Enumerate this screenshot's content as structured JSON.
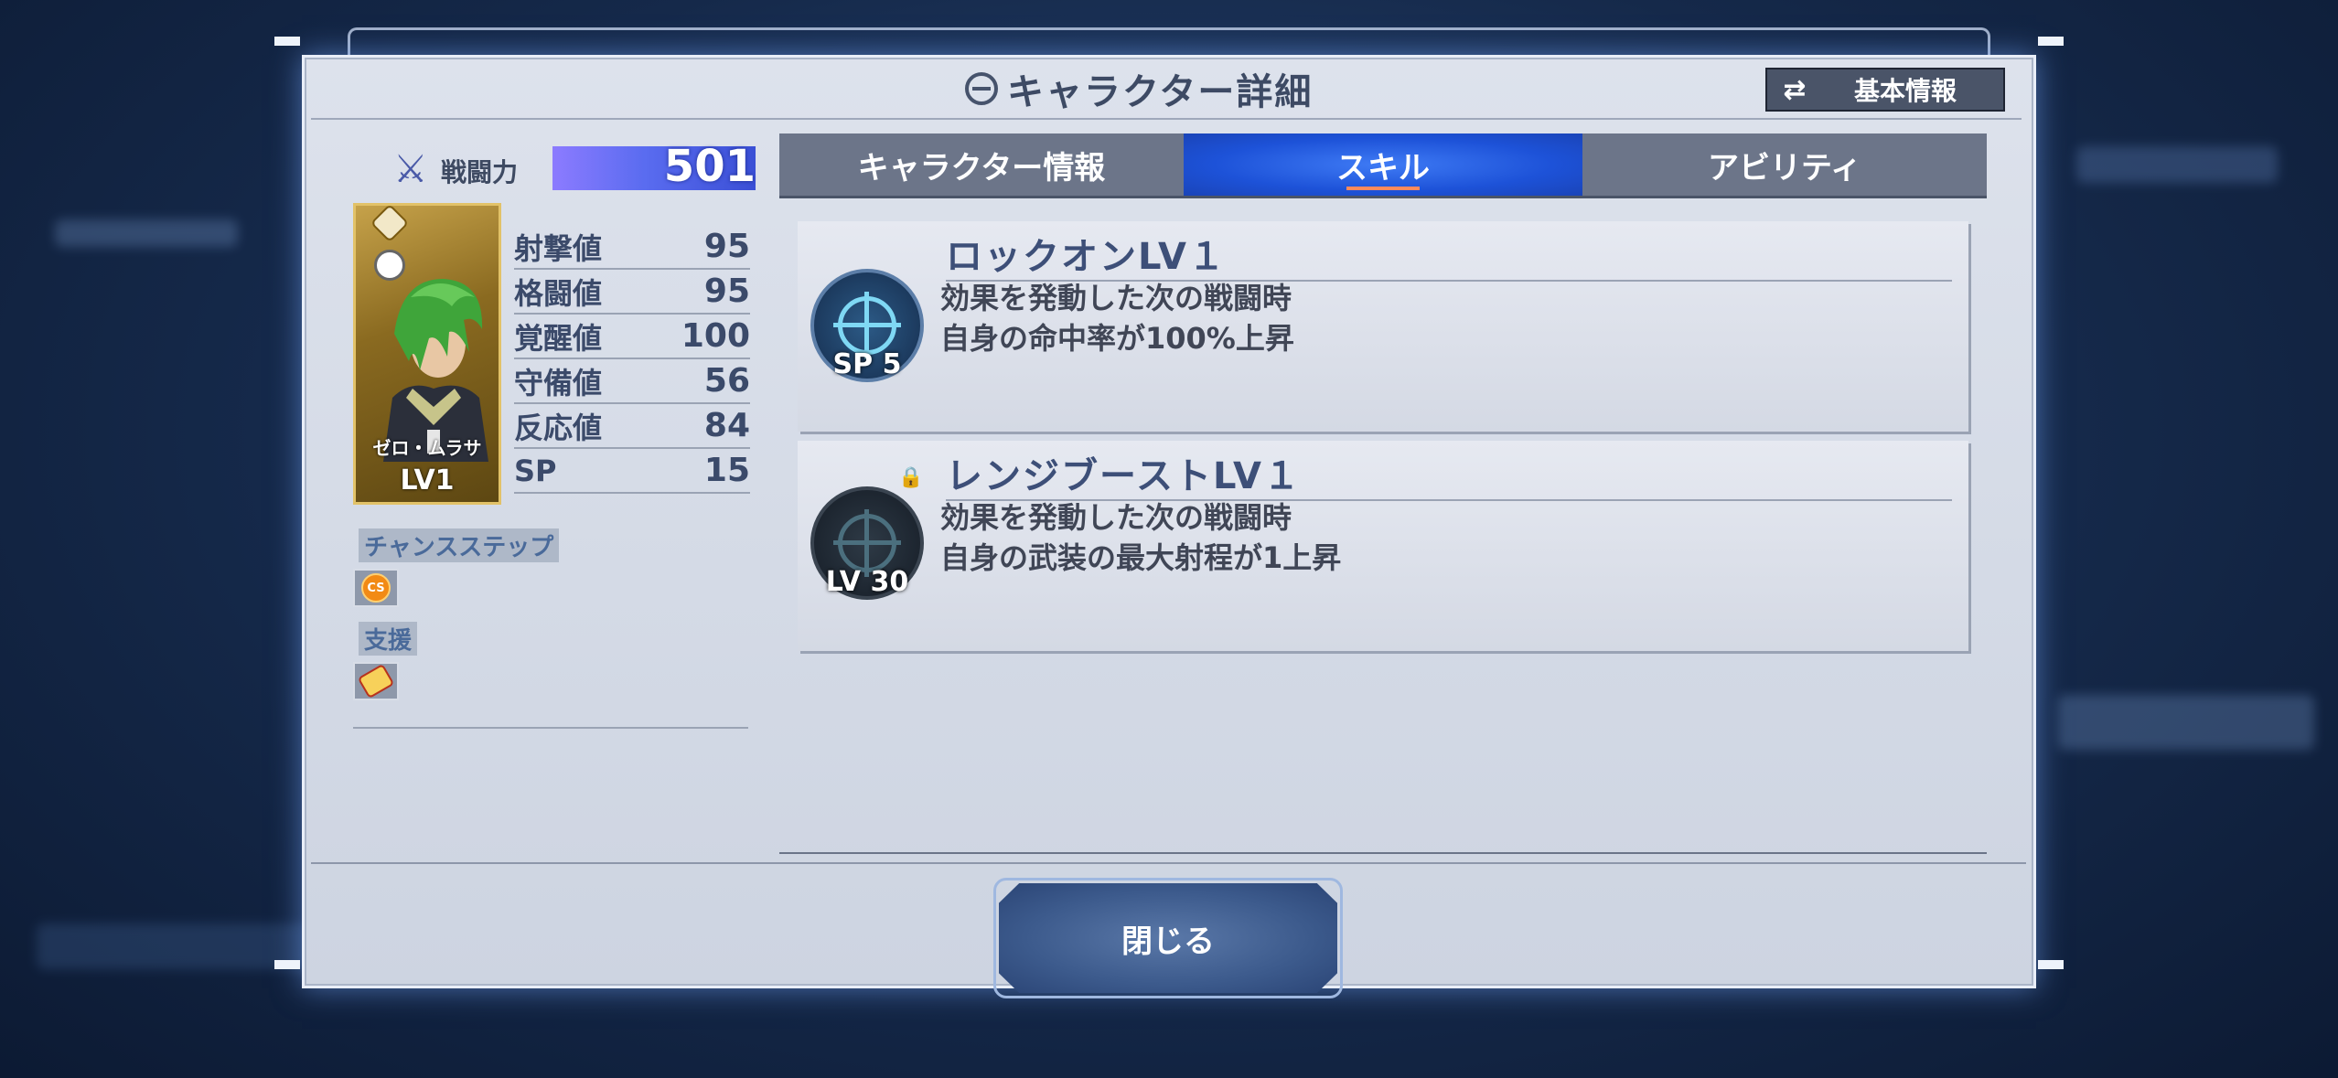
{
  "header": {
    "title": "キャラクター詳細",
    "basic_info_label": "基本情報"
  },
  "character": {
    "combat_power_label": "戦闘力",
    "combat_power": "501",
    "name": "ゼロ・ムラサ",
    "level": "LV1",
    "stats": [
      {
        "name": "射撃値",
        "value": "95"
      },
      {
        "name": "格闘値",
        "value": "95"
      },
      {
        "name": "覚醒値",
        "value": "100"
      },
      {
        "name": "守備値",
        "value": "56"
      },
      {
        "name": "反応値",
        "value": "84"
      },
      {
        "name": "SP",
        "value": "15"
      }
    ],
    "chance_step_label": "チャンスステップ",
    "chance_step_icon_text": "CS",
    "support_label": "支援"
  },
  "tabs": [
    {
      "label": "キャラクター情報",
      "active": false
    },
    {
      "label": "スキル",
      "active": true
    },
    {
      "label": "アビリティ",
      "active": false
    }
  ],
  "skills": [
    {
      "title": "ロックオンLV１",
      "badge": "SP 5",
      "locked": false,
      "desc": [
        "効果を発動した次の戦闘時",
        "自身の命中率が100%上昇"
      ]
    },
    {
      "title": "レンジブーストLV１",
      "badge": "LV 30",
      "locked": true,
      "desc": [
        "効果を発動した次の戦闘時",
        "自身の武装の最大射程が1上昇"
      ]
    }
  ],
  "footer": {
    "close_label": "閉じる"
  },
  "colors": {
    "active_tab": "#1d52d8",
    "power_bar": "#5a6cf0",
    "accent_underline": "#ff8a5c"
  }
}
